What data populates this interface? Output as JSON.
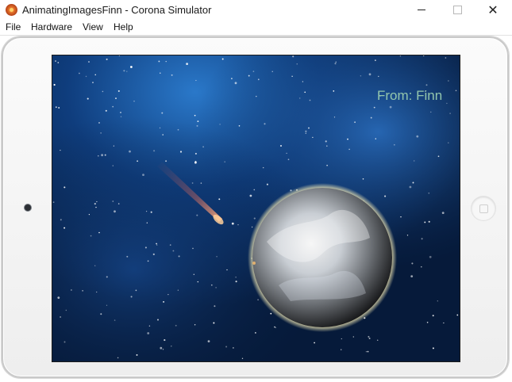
{
  "window": {
    "title": "AnimatingImagesFinn - Corona Simulator",
    "icon": "corona-app-icon",
    "controls": {
      "minimize_icon": "minimize-icon",
      "maximize_icon": "maximize-icon",
      "close_icon": "close-icon"
    }
  },
  "menu": {
    "items": [
      "File",
      "Hardware",
      "View",
      "Help"
    ]
  },
  "device": {
    "camera_icon": "camera-icon",
    "home_button_icon": "home-button-icon"
  },
  "screen": {
    "caption": "From: Finn",
    "images": [
      "starfield-background",
      "comet",
      "planet"
    ],
    "colors": {
      "sky_deep": "#061a3a",
      "sky_glow": "#1f68b8",
      "caption": "#93c6ad"
    }
  }
}
